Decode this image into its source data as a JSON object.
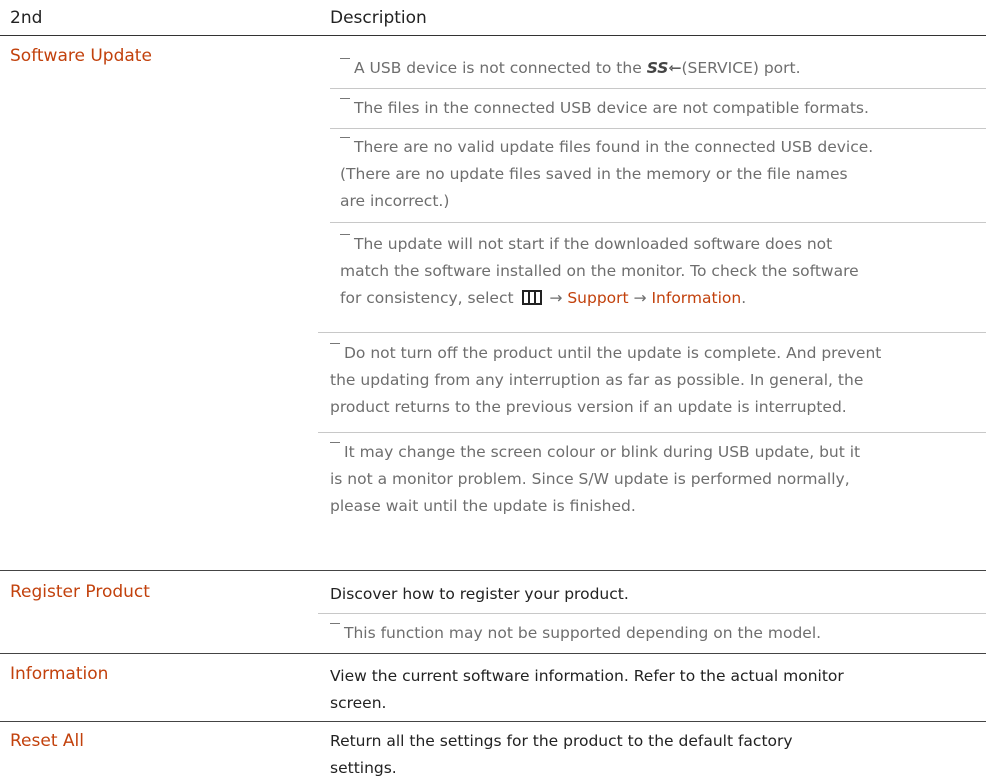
{
  "header": {
    "col1": "2nd",
    "col2": "Description"
  },
  "software_update": {
    "name": "Software Update",
    "note1_pre": "A USB device is not connected to the ",
    "note1_usb": "SS⇽",
    "note1_post": "(SERVICE) port.",
    "note2": "The files in the connected USB device are not compatible formats.",
    "note3_line1": "There are no valid update files found in the connected USB device.",
    "note3_line2": "(There are no update files saved in the memory or the file names",
    "note3_line3": "are incorrect.)",
    "note4_line1": "The update will not start if the downloaded software does not",
    "note4_line2": "match the software installed on the monitor. To check the software",
    "note4_line3_pre": "for consistency, select ",
    "note4_arrow1": " → ",
    "note4_link1": "Support",
    "note4_arrow2": " → ",
    "note4_link2": "Information",
    "note4_end": ".",
    "note5_line1": "Do not turn off the product until the update is complete. And prevent",
    "note5_line2": "the updating from any interruption as far as possible. In general, the",
    "note5_line3": "product returns to the previous version if an update is interrupted.",
    "note6_line1": "It may change the screen colour or blink during USB update, but it",
    "note6_line2": "is not a monitor problem. Since S/W update is performed normally,",
    "note6_line3": "please wait until the update is finished."
  },
  "register_product": {
    "name": "Register Product",
    "desc": "Discover how to register your product.",
    "note": "This function may not be supported depending on the model."
  },
  "information": {
    "name": "Information",
    "desc_line1": "View the current software information. Refer to the actual monitor",
    "desc_line2": "screen."
  },
  "reset_all": {
    "name": "Reset All",
    "desc_line1": "Return all the settings for the product to the default factory",
    "desc_line2": "settings."
  },
  "colors": {
    "accent": "#c2410c",
    "note": "#6e6e6e",
    "text": "#222222"
  }
}
